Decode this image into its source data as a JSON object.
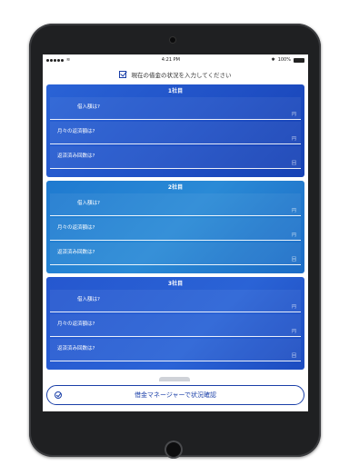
{
  "status": {
    "time": "4:21 PM",
    "battery": "100%"
  },
  "header": {
    "title": "現在の借金の状況を入力してください"
  },
  "cards": [
    {
      "title": "1社目",
      "fields": [
        {
          "label": "借入額は?",
          "unit": "円"
        },
        {
          "label": "月々の返済額は?",
          "unit": "円"
        },
        {
          "label": "返済済み回数は?",
          "unit": "回"
        }
      ]
    },
    {
      "title": "2社目",
      "fields": [
        {
          "label": "借入額は?",
          "unit": "円"
        },
        {
          "label": "月々の返済額は?",
          "unit": "円"
        },
        {
          "label": "返済済み回数は?",
          "unit": "回"
        }
      ]
    },
    {
      "title": "3社目",
      "fields": [
        {
          "label": "借入額は?",
          "unit": "円"
        },
        {
          "label": "月々の返済額は?",
          "unit": "円"
        },
        {
          "label": "返済済み回数は?",
          "unit": "回"
        }
      ]
    }
  ],
  "cta": {
    "label": "借金マネージャーで状況確認"
  },
  "colors": {
    "accent": "#1a3fa8",
    "card_blue": "#2a63d6"
  }
}
